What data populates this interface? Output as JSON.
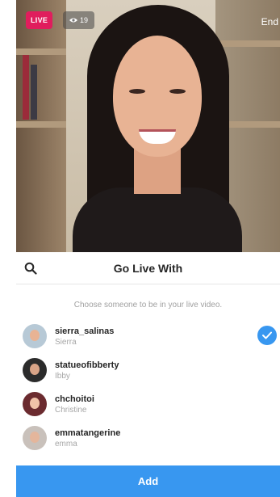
{
  "live": {
    "badge_label": "LIVE",
    "viewer_count": "19",
    "end_label": "End"
  },
  "sheet": {
    "title": "Go Live With",
    "hint": "Choose someone to be in your live video.",
    "users": [
      {
        "username": "sierra_salinas",
        "fullname": "Sierra",
        "selected": true
      },
      {
        "username": "statueofibberty",
        "fullname": "Ibby",
        "selected": false
      },
      {
        "username": "chchoitoi",
        "fullname": "Christine",
        "selected": false
      },
      {
        "username": "emmatangerine",
        "fullname": "emma",
        "selected": false
      }
    ],
    "add_label": "Add"
  },
  "colors": {
    "live_badge": "#e01d5d",
    "accent_blue": "#3897f0"
  },
  "icons": [
    "eye-icon",
    "search-icon",
    "checkmark-icon"
  ]
}
